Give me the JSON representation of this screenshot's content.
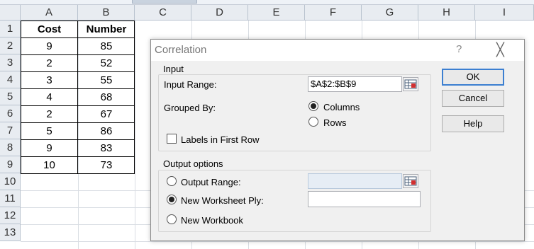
{
  "spreadsheet": {
    "columns": [
      "A",
      "B",
      "C",
      "D",
      "E",
      "F",
      "G",
      "H",
      "I"
    ],
    "rows": [
      "1",
      "2",
      "3",
      "4",
      "5",
      "6",
      "7",
      "8",
      "9",
      "10",
      "11",
      "12",
      "13"
    ],
    "headers": {
      "a1": "Cost",
      "b1": "Number"
    },
    "data": [
      {
        "a": "9",
        "b": "85"
      },
      {
        "a": "2",
        "b": "52"
      },
      {
        "a": "3",
        "b": "55"
      },
      {
        "a": "4",
        "b": "68"
      },
      {
        "a": "2",
        "b": "67"
      },
      {
        "a": "5",
        "b": "86"
      },
      {
        "a": "9",
        "b": "83"
      },
      {
        "a": "10",
        "b": "73"
      }
    ]
  },
  "dialog": {
    "title": "Correlation",
    "help_glyph": "?",
    "close_glyph": "╳",
    "input": {
      "group_label": "Input",
      "range_label": "Input Range:",
      "range_value": "$A$2:$B$9",
      "grouped_by_label": "Grouped By:",
      "columns_label": "Columns",
      "rows_label": "Rows",
      "labels_first_row": "Labels in First Row"
    },
    "output": {
      "group_label": "Output options",
      "output_range_label": "Output Range:",
      "output_range_value": "",
      "new_ply_label": "New Worksheet Ply:",
      "new_ply_value": "",
      "new_workbook_label": "New Workbook"
    },
    "buttons": {
      "ok": "OK",
      "cancel": "Cancel",
      "help": "Help"
    }
  }
}
